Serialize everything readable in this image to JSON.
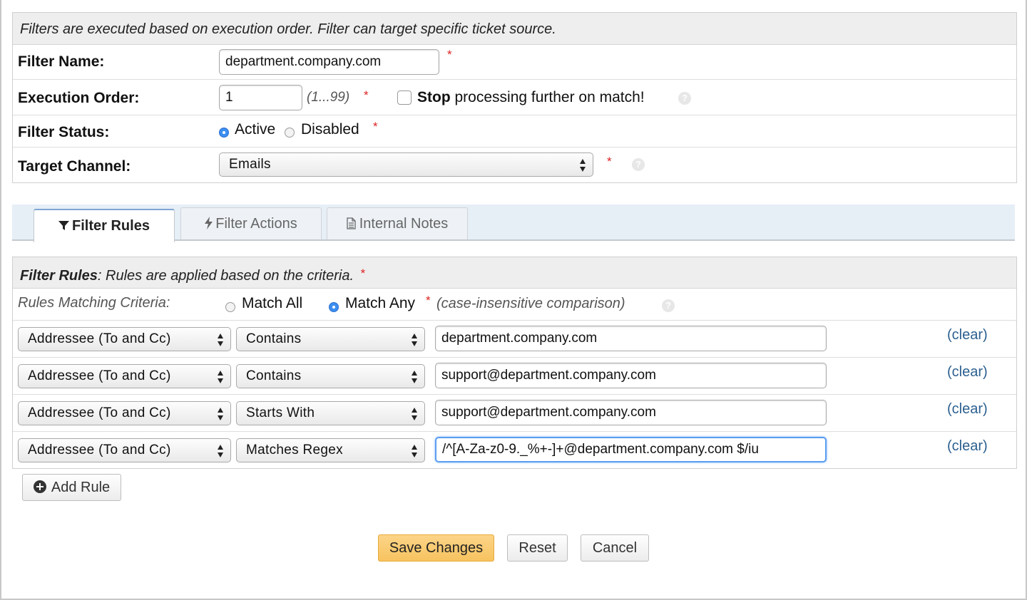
{
  "header": {
    "note": "Filters are executed based on execution order. Filter can target specific ticket source."
  },
  "form": {
    "filter_name": {
      "label": "Filter Name:",
      "value": "department.company.com"
    },
    "execution_order": {
      "label": "Execution Order:",
      "value": "1",
      "hint": "(1...99)",
      "stop_bold": "Stop",
      "stop_rest": "processing further on match!"
    },
    "filter_status": {
      "label": "Filter Status:",
      "active": "Active",
      "disabled": "Disabled",
      "selected": "Active"
    },
    "target_channel": {
      "label": "Target Channel:",
      "value": "Emails"
    },
    "required_mark": "*",
    "help_glyph": "?"
  },
  "tabs": [
    {
      "label": "Filter Rules",
      "icon": "funnel-icon",
      "active": true
    },
    {
      "label": "Filter Actions",
      "icon": "bolt-icon",
      "active": false
    },
    {
      "label": "Internal Notes",
      "icon": "document-icon",
      "active": false
    }
  ],
  "rules": {
    "header_bold": "Filter Rules",
    "header_rest": ": Rules are applied based on the criteria.",
    "criteria_label": "Rules Matching Criteria:",
    "match_all": "Match All",
    "match_any": "Match Any",
    "match_selected": "Match Any",
    "comparison_note": "(case-insensitive comparison)",
    "items": [
      {
        "field": "Addressee (To and Cc)",
        "op": "Contains",
        "value": "department.company.com",
        "clear": "(clear)"
      },
      {
        "field": "Addressee (To and Cc)",
        "op": "Contains",
        "value": "support@department.company.com",
        "clear": "(clear)"
      },
      {
        "field": "Addressee (To and Cc)",
        "op": "Starts With",
        "value": "support@department.company.com",
        "clear": "(clear)"
      },
      {
        "field": "Addressee (To and Cc)",
        "op": "Matches Regex",
        "value": "/^[A-Za-z0-9._%+-]+@department.company.com $/iu",
        "clear": "(clear)"
      }
    ],
    "add_rule": "Add Rule"
  },
  "actions": {
    "save": "Save Changes",
    "reset": "Reset",
    "cancel": "Cancel"
  },
  "colors": {
    "accent": "#f7c35f",
    "link": "#2b5f8f",
    "required": "#dd2222",
    "focus": "#5b9df0"
  }
}
